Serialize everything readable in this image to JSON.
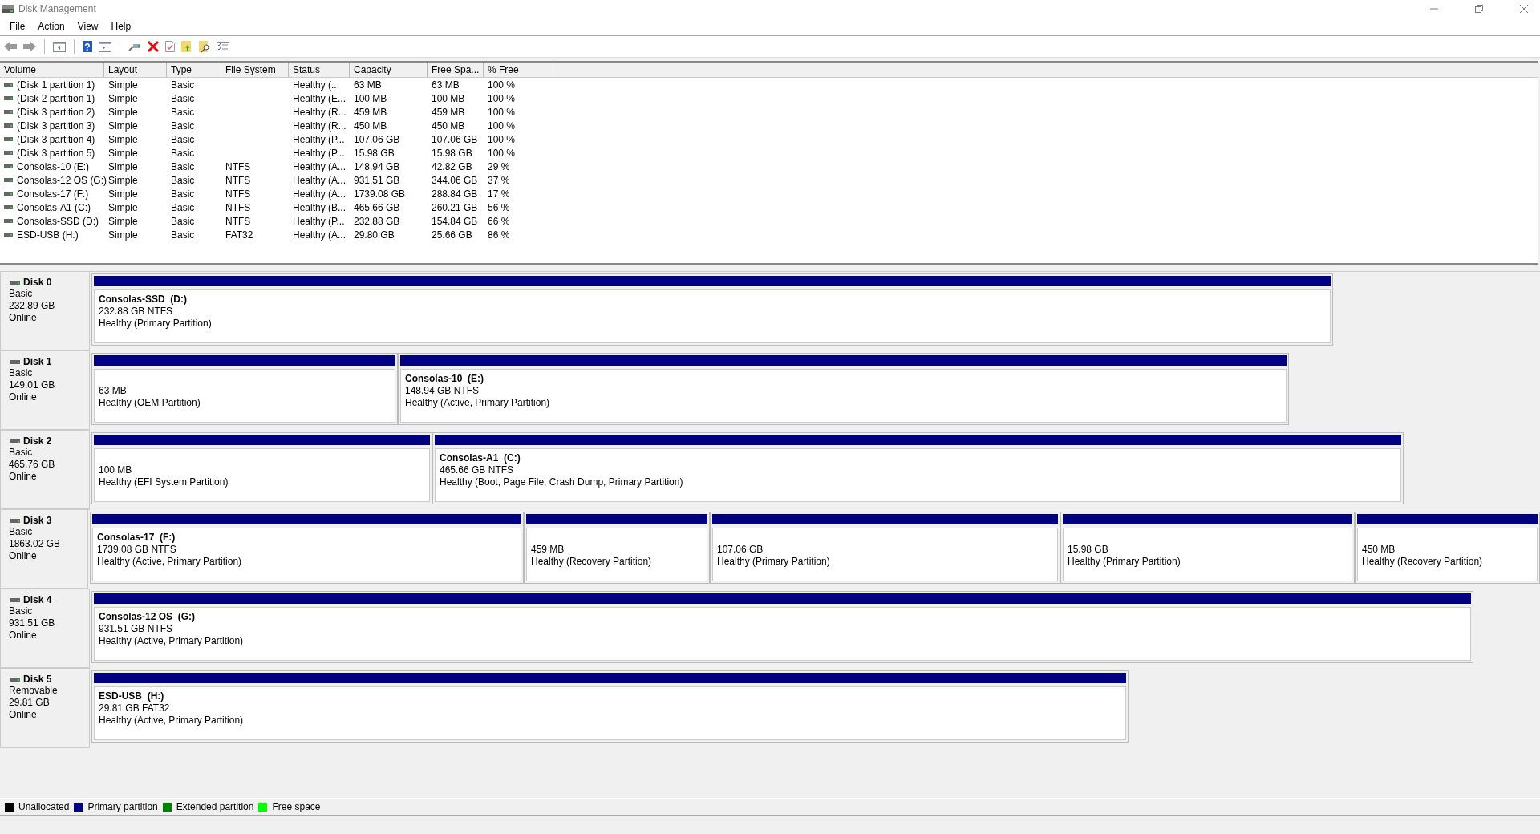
{
  "window": {
    "title": "Disk Management"
  },
  "menu": [
    "File",
    "Action",
    "View",
    "Help"
  ],
  "toolbar": {
    "help_glyph": "?"
  },
  "volume_table": {
    "columns": [
      "Volume",
      "Layout",
      "Type",
      "File System",
      "Status",
      "Capacity",
      "Free Spa...",
      "% Free"
    ],
    "rows": [
      {
        "volume": "(Disk 1 partition 1)",
        "layout": "Simple",
        "type": "Basic",
        "status": "Healthy (...",
        "capacity": "63 MB",
        "free_space": "63 MB",
        "percent_free": "100 %"
      },
      {
        "volume": "(Disk 2 partition 1)",
        "layout": "Simple",
        "type": "Basic",
        "status": "Healthy (E...",
        "capacity": "100 MB",
        "free_space": "100 MB",
        "percent_free": "100 %"
      },
      {
        "volume": "(Disk 3 partition 2)",
        "layout": "Simple",
        "type": "Basic",
        "status": "Healthy (R...",
        "capacity": "459 MB",
        "free_space": "459 MB",
        "percent_free": "100 %"
      },
      {
        "volume": "(Disk 3 partition 3)",
        "layout": "Simple",
        "type": "Basic",
        "status": "Healthy (R...",
        "capacity": "450 MB",
        "free_space": "450 MB",
        "percent_free": "100 %"
      },
      {
        "volume": "(Disk 3 partition 4)",
        "layout": "Simple",
        "type": "Basic",
        "status": "Healthy (P...",
        "capacity": "107.06 GB",
        "free_space": "107.06 GB",
        "percent_free": "100 %"
      },
      {
        "volume": "(Disk 3 partition 5)",
        "layout": "Simple",
        "type": "Basic",
        "status": "Healthy (P...",
        "capacity": "15.98 GB",
        "free_space": "15.98 GB",
        "percent_free": "100 %"
      },
      {
        "volume": "Consolas-10 (E:)",
        "layout": "Simple",
        "type": "Basic",
        "file_system": "NTFS",
        "status": "Healthy (A...",
        "capacity": "148.94 GB",
        "free_space": "42.82 GB",
        "percent_free": "29 %"
      },
      {
        "volume": "Consolas-12 OS (G:)",
        "layout": "Simple",
        "type": "Basic",
        "file_system": "NTFS",
        "status": "Healthy (A...",
        "capacity": "931.51 GB",
        "free_space": "344.06 GB",
        "percent_free": "37 %"
      },
      {
        "volume": "Consolas-17 (F:)",
        "layout": "Simple",
        "type": "Basic",
        "file_system": "NTFS",
        "status": "Healthy (A...",
        "capacity": "1739.08 GB",
        "free_space": "288.84 GB",
        "percent_free": "17 %"
      },
      {
        "volume": "Consolas-A1 (C:)",
        "layout": "Simple",
        "type": "Basic",
        "file_system": "NTFS",
        "status": "Healthy (B...",
        "capacity": "465.66 GB",
        "free_space": "260.21 GB",
        "percent_free": "56 %"
      },
      {
        "volume": "Consolas-SSD (D:)",
        "layout": "Simple",
        "type": "Basic",
        "file_system": "NTFS",
        "status": "Healthy (P...",
        "capacity": "232.88 GB",
        "free_space": "154.84 GB",
        "percent_free": "66 %"
      },
      {
        "volume": "ESD-USB (H:)",
        "layout": "Simple",
        "type": "Basic",
        "file_system": "FAT32",
        "status": "Healthy (A...",
        "capacity": "29.80 GB",
        "free_space": "25.66 GB",
        "percent_free": "86 %"
      }
    ]
  },
  "disks": [
    {
      "name": "Disk 0",
      "type": "Basic",
      "size": "232.89 GB",
      "status": "Online",
      "partitions": [
        {
          "label": "Consolas-SSD  (D:)",
          "size": "232.88 GB NTFS",
          "status": "Healthy (Primary Partition)"
        }
      ]
    },
    {
      "name": "Disk 1",
      "type": "Basic",
      "size": "149.01 GB",
      "status": "Online",
      "partitions": [
        {
          "size": "63 MB",
          "status": "Healthy (OEM Partition)"
        },
        {
          "label": "Consolas-10  (E:)",
          "size": "148.94 GB NTFS",
          "status": "Healthy (Active, Primary Partition)"
        }
      ]
    },
    {
      "name": "Disk 2",
      "type": "Basic",
      "size": "465.76 GB",
      "status": "Online",
      "partitions": [
        {
          "size": "100 MB",
          "status": "Healthy (EFI System Partition)"
        },
        {
          "label": "Consolas-A1  (C:)",
          "size": "465.66 GB NTFS",
          "status": "Healthy (Boot, Page File, Crash Dump, Primary Partition)"
        }
      ]
    },
    {
      "name": "Disk 3",
      "type": "Basic",
      "size": "1863.02 GB",
      "status": "Online",
      "partitions": [
        {
          "label": "Consolas-17  (F:)",
          "size": "1739.08 GB NTFS",
          "status": "Healthy (Active, Primary Partition)"
        },
        {
          "size": "459 MB",
          "status": "Healthy (Recovery Partition)"
        },
        {
          "size": "107.06 GB",
          "status": "Healthy (Primary Partition)"
        },
        {
          "size": "15.98 GB",
          "status": "Healthy (Primary Partition)"
        },
        {
          "size": "450 MB",
          "status": "Healthy (Recovery Partition)"
        }
      ]
    },
    {
      "name": "Disk 4",
      "type": "Basic",
      "size": "931.51 GB",
      "status": "Online",
      "partitions": [
        {
          "label": "Consolas-12 OS  (G:)",
          "size": "931.51 GB NTFS",
          "status": "Healthy (Active, Primary Partition)"
        }
      ]
    },
    {
      "name": "Disk 5",
      "type": "Removable",
      "size": "29.81 GB",
      "status": "Online",
      "partitions": [
        {
          "label": "ESD-USB  (H:)",
          "size": "29.81 GB FAT32",
          "status": "Healthy (Active, Primary Partition)"
        }
      ]
    }
  ],
  "legend": [
    {
      "label": "Unallocated",
      "color": "#000000"
    },
    {
      "label": "Primary partition",
      "color": "#000080"
    },
    {
      "label": "Extended partition",
      "color": "#008000"
    },
    {
      "label": "Free space",
      "color": "#00ff00"
    }
  ]
}
